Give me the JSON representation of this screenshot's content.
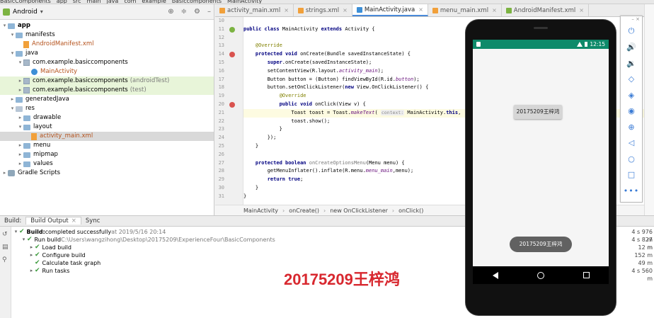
{
  "breadcrumb": [
    "BasicComponents",
    "app",
    "src",
    "main",
    "java",
    "com",
    "example",
    "basiccomponents",
    "MainActivity"
  ],
  "run_config": "app",
  "project": {
    "view_selector": "Android",
    "tree": [
      {
        "label": "app",
        "indent": 0,
        "arrow": "▾",
        "icon": "folder",
        "style": "bold"
      },
      {
        "label": "manifests",
        "indent": 1,
        "arrow": "▾",
        "icon": "folder"
      },
      {
        "label": "AndroidManifest.xml",
        "indent": 2,
        "arrow": "",
        "icon": "xml",
        "style": "orange"
      },
      {
        "label": "java",
        "indent": 1,
        "arrow": "▾",
        "icon": "folder"
      },
      {
        "label": "com.example.basiccomponents",
        "indent": 2,
        "arrow": "▾",
        "icon": "pkg"
      },
      {
        "label": "MainActivity",
        "indent": 3,
        "arrow": "",
        "icon": "class",
        "style": "orange"
      },
      {
        "label": "com.example.basiccomponents",
        "suffix": "(androidTest)",
        "indent": 2,
        "arrow": "▸",
        "icon": "pkg",
        "row": "green"
      },
      {
        "label": "com.example.basiccomponents",
        "suffix": "(test)",
        "indent": 2,
        "arrow": "▸",
        "icon": "pkg",
        "row": "green"
      },
      {
        "label": "generatedJava",
        "indent": 1,
        "arrow": "▸",
        "icon": "folder"
      },
      {
        "label": "res",
        "indent": 1,
        "arrow": "▾",
        "icon": "res"
      },
      {
        "label": "drawable",
        "indent": 2,
        "arrow": "▸",
        "icon": "folder"
      },
      {
        "label": "layout",
        "indent": 2,
        "arrow": "▾",
        "icon": "folder"
      },
      {
        "label": "activity_main.xml",
        "indent": 3,
        "arrow": "",
        "icon": "xml",
        "style": "orange",
        "row": "selected"
      },
      {
        "label": "menu",
        "indent": 2,
        "arrow": "▸",
        "icon": "folder"
      },
      {
        "label": "mipmap",
        "indent": 2,
        "arrow": "▸",
        "icon": "folder"
      },
      {
        "label": "values",
        "indent": 2,
        "arrow": "▸",
        "icon": "folder"
      },
      {
        "label": "Gradle Scripts",
        "indent": 0,
        "arrow": "▸",
        "icon": "gradle"
      }
    ]
  },
  "editor": {
    "tabs": [
      {
        "label": "activity_main.xml",
        "icon_color": "#f1a03a",
        "active": false
      },
      {
        "label": "strings.xml",
        "icon_color": "#f1a03a",
        "active": false
      },
      {
        "label": "MainActivity.java",
        "icon_color": "#3d8fd6",
        "active": true
      },
      {
        "label": "menu_main.xml",
        "icon_color": "#f1a03a",
        "active": false
      },
      {
        "label": "AndroidManifest.xml",
        "icon_color": "#7cb342",
        "active": false
      }
    ],
    "line_numbers": [
      "10",
      "11",
      "12",
      "13",
      "14",
      "15",
      "16",
      "17",
      "18",
      "19",
      "20",
      "21",
      "22",
      "23",
      "24",
      "25",
      "26",
      "27",
      "28",
      "29",
      "30",
      "31"
    ],
    "code_lines": [
      {
        "html": ""
      },
      {
        "html": "<span class=\"kw\">public class</span> MainActivity <span class=\"kw\">extends</span> Activity {"
      },
      {
        "html": ""
      },
      {
        "html": "    <span class=\"an\">@Override</span>"
      },
      {
        "html": "    <span class=\"kw\">protected void</span> onCreate(Bundle savedInstanceState) {"
      },
      {
        "html": "        <span class=\"kw\">super</span>.onCreate(savedInstanceState);"
      },
      {
        "html": "        setContentView(R.layout.<span class=\"it\">activity_main</span>);"
      },
      {
        "html": "        Button button = (Button) findViewById(R.id.<span class=\"it\">button</span>);"
      },
      {
        "html": "        button.setOnClickListener(<span class=\"kw\">new</span> View.OnClickListener() {"
      },
      {
        "html": "            <span class=\"an\">@Override</span>"
      },
      {
        "html": "            <span class=\"kw\">public void</span> onClick(View v) {"
      },
      {
        "html": "                Toast toast = Toast.<span class=\"it\">makeText</span>( <span class=\"hint\">context:</span> MainActivity.<span class=\"kw\">this</span>,  <span class=\"hint\">text:</span> \"",
        "hl": true
      },
      {
        "html": "                toast.show();"
      },
      {
        "html": "            }"
      },
      {
        "html": "        });"
      },
      {
        "html": "    }"
      },
      {
        "html": ""
      },
      {
        "html": "    <span class=\"kw\">protected boolean</span> <span class=\"t-gray\">onCreateOptionsMenu</span>(Menu menu) {"
      },
      {
        "html": "        getMenuInflater().inflate(R.menu.<span class=\"it\">menu_main</span>,menu);"
      },
      {
        "html": "        <span class=\"kw\">return true</span>;"
      },
      {
        "html": "    }"
      },
      {
        "html": "}"
      }
    ],
    "breadcrumb": [
      "MainActivity",
      "onCreate()",
      "new OnClickListener",
      "onClick()"
    ]
  },
  "build": {
    "label": "Build:",
    "tabs": [
      {
        "label": "Build Output",
        "active": true
      },
      {
        "label": "Sync",
        "active": false
      }
    ],
    "rows": [
      {
        "indent": 0,
        "arrow": "▾",
        "text_bold": "Build:",
        "text": " completed successfully",
        "meta": " at 2019/5/16 20:14",
        "time": "4 s 976 m"
      },
      {
        "indent": 1,
        "arrow": "▾",
        "text": "Run build",
        "meta": " C:\\Users\\wangzihong\\Desktop\\20175209\\ExperienceFour\\BasicComponents",
        "time": "4 s 827 m"
      },
      {
        "indent": 2,
        "arrow": "▸",
        "text": "Load build",
        "meta": "",
        "time": "12 m"
      },
      {
        "indent": 2,
        "arrow": "▸",
        "text": "Configure build",
        "meta": "",
        "time": "152 m"
      },
      {
        "indent": 2,
        "arrow": "",
        "text": "Calculate task graph",
        "meta": "",
        "time": "49 m"
      },
      {
        "indent": 2,
        "arrow": "▸",
        "text": "Run tasks",
        "meta": "",
        "time": "4 s 560 m"
      }
    ],
    "watermark": "20175209王梓鸿"
  },
  "emulator": {
    "time": "12:15",
    "button_label": "20175209王梓鸿",
    "toast_text": "20175209王梓鸿",
    "status_color": "#0e8a6a",
    "toolbar": [
      {
        "name": "power-icon",
        "glyph": "⏻"
      },
      {
        "name": "volume-up-icon",
        "glyph": "🔊"
      },
      {
        "name": "volume-down-icon",
        "glyph": "🔉"
      },
      {
        "name": "rotate-left-icon",
        "glyph": "◇"
      },
      {
        "name": "rotate-right-icon",
        "glyph": "◈"
      },
      {
        "name": "camera-icon",
        "glyph": "◉"
      },
      {
        "name": "zoom-icon",
        "glyph": "⊕"
      },
      {
        "name": "back-icon",
        "glyph": "◁"
      },
      {
        "name": "home-icon",
        "glyph": "○"
      },
      {
        "name": "overview-icon",
        "glyph": "□"
      },
      {
        "name": "more-icon",
        "glyph": "•••"
      }
    ]
  }
}
